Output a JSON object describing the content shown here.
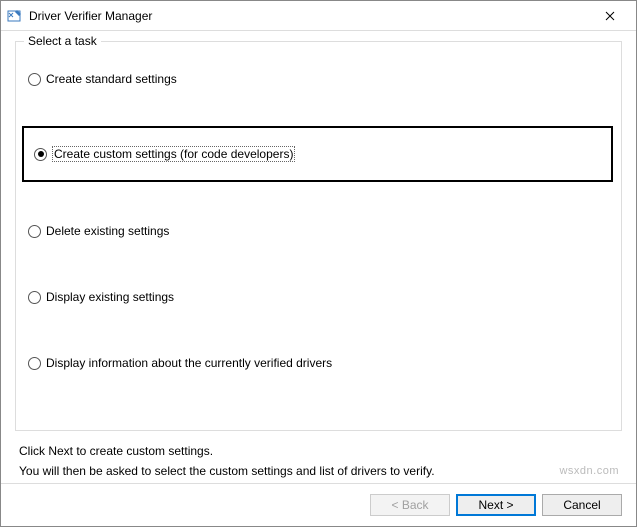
{
  "window": {
    "title": "Driver Verifier Manager"
  },
  "group": {
    "label": "Select a task"
  },
  "options": {
    "create_standard": "Create standard settings",
    "create_custom": "Create custom settings (for code developers)",
    "delete_existing": "Delete existing settings",
    "display_existing": "Display existing settings",
    "display_info": "Display information about the currently verified drivers"
  },
  "selected": "create_custom",
  "instructions": {
    "line1": "Click Next to create custom settings.",
    "line2": "You will then be asked to select the custom settings and list of drivers to verify."
  },
  "buttons": {
    "back": "< Back",
    "next": "Next >",
    "cancel": "Cancel"
  },
  "watermark": "wsxdn.com"
}
